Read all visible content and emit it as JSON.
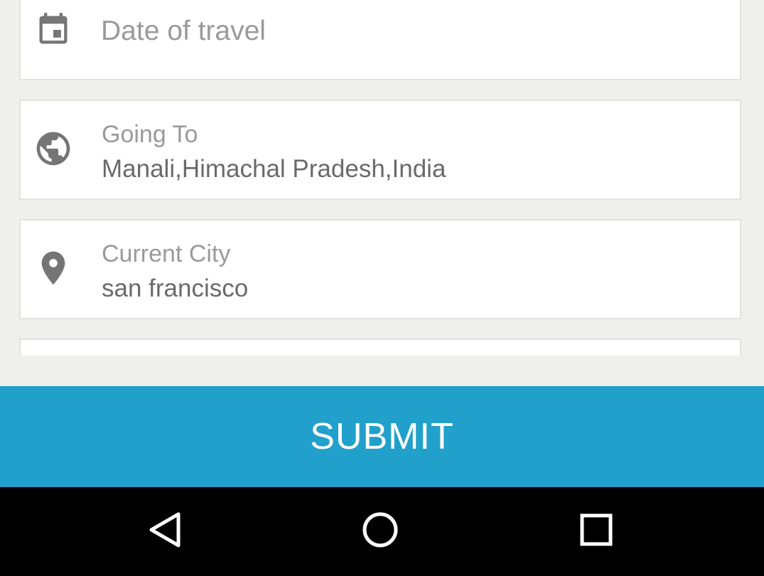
{
  "form": {
    "date_field": {
      "placeholder": "Date of travel",
      "icon": "calendar-icon"
    },
    "going_to_field": {
      "label": "Going To",
      "value": "Manali,Himachal Pradesh,India",
      "icon": "globe-icon"
    },
    "current_city_field": {
      "label": "Current City",
      "value": "san francisco",
      "icon": "location-pin-icon"
    }
  },
  "submit": {
    "label": "SUBMIT",
    "color": "#21a0cb"
  },
  "nav": {
    "back_icon": "back-triangle-icon",
    "home_icon": "home-circle-icon",
    "recent_icon": "recent-apps-square-icon"
  },
  "colors": {
    "background": "#efefed",
    "icon": "#757575",
    "label": "#9a9a9a",
    "value": "#6a6a6a"
  }
}
